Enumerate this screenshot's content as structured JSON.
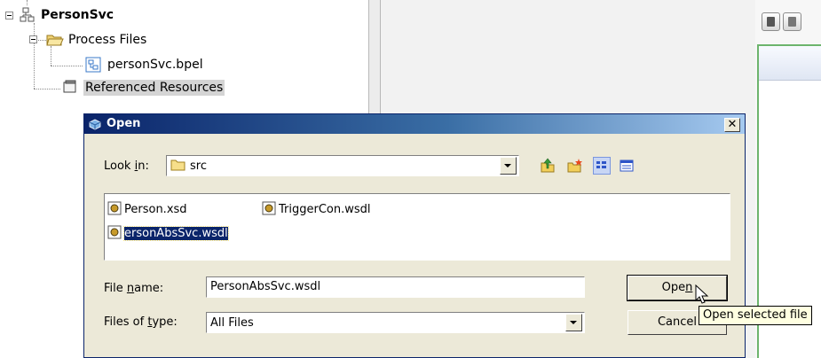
{
  "project_tree": {
    "root": "PersonSvc",
    "process_files": "Process Files",
    "bpel_file": "personSvc.bpel",
    "referenced_resources": "Referenced Resources"
  },
  "dialog": {
    "title": "Open",
    "close_glyph": "✕",
    "look_in": {
      "label_pre": "Look ",
      "label_key": "i",
      "label_post": "n:",
      "value": "src"
    },
    "toolbar_icons": [
      "up-folder-icon",
      "new-folder-icon",
      "list-view-icon",
      "details-view-icon"
    ],
    "files": [
      {
        "name": "Person.xsd",
        "selected": false
      },
      {
        "name": "TriggerCon.wsdl",
        "selected": false
      },
      {
        "name": "ersonAbsSvc.wsdl",
        "selected": true
      }
    ],
    "file_name": {
      "label_pre": "File ",
      "label_key": "n",
      "label_post": "ame:",
      "value": "PersonAbsSvc.wsdl"
    },
    "file_type": {
      "label_pre": "Files of ",
      "label_key": "t",
      "label_post": "ype:",
      "value": "All Files"
    },
    "open_button": {
      "label_pre": "Ope",
      "label_key": "n",
      "label_post": ""
    },
    "cancel_button": "Cancel",
    "tooltip": "Open selected file"
  },
  "colors": {
    "title_start": "#0a246a",
    "title_end": "#a6caf0",
    "dialog_bg": "#ece9d8",
    "selection": "#0a246a",
    "tooltip_bg": "#ffffe1"
  }
}
